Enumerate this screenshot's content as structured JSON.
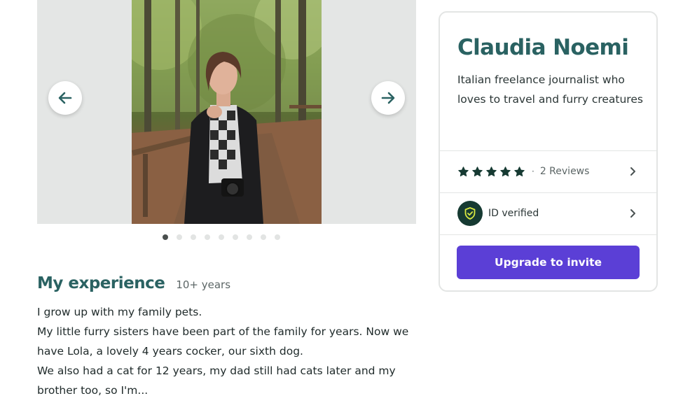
{
  "gallery": {
    "total_images": 9,
    "active_index": 0,
    "photo_alt": "Claudia Noemi"
  },
  "experience": {
    "title": "My experience",
    "years": "10+ years",
    "lines": [
      "I grow up with my family pets.",
      "My little furry sisters have been part of the family for years. Now we have Lola, a lovely 4 years cocker, our sixth dog.",
      "We also had a cat for 12 years, my dad still had cats later and my brother too, so I'm..."
    ]
  },
  "profile": {
    "name": "Claudia Noemi",
    "bio": "Italian freelance journalist who loves to travel and furry creatures",
    "rating_stars": 5,
    "bullet": "·",
    "reviews_label": "2 Reviews",
    "verified_label": "ID verified",
    "upgrade_label": "Upgrade to invite"
  },
  "icons": {
    "prev": "arrow-left-icon",
    "next": "arrow-right-icon",
    "star": "star-icon",
    "chevron": "chevron-right-icon",
    "shield": "shield-check-icon"
  },
  "colors": {
    "brand_teal": "#2a6262",
    "cta_purple": "#5b3fd6",
    "shield_badge": "#163a32",
    "shield_accent": "#d8e840"
  }
}
